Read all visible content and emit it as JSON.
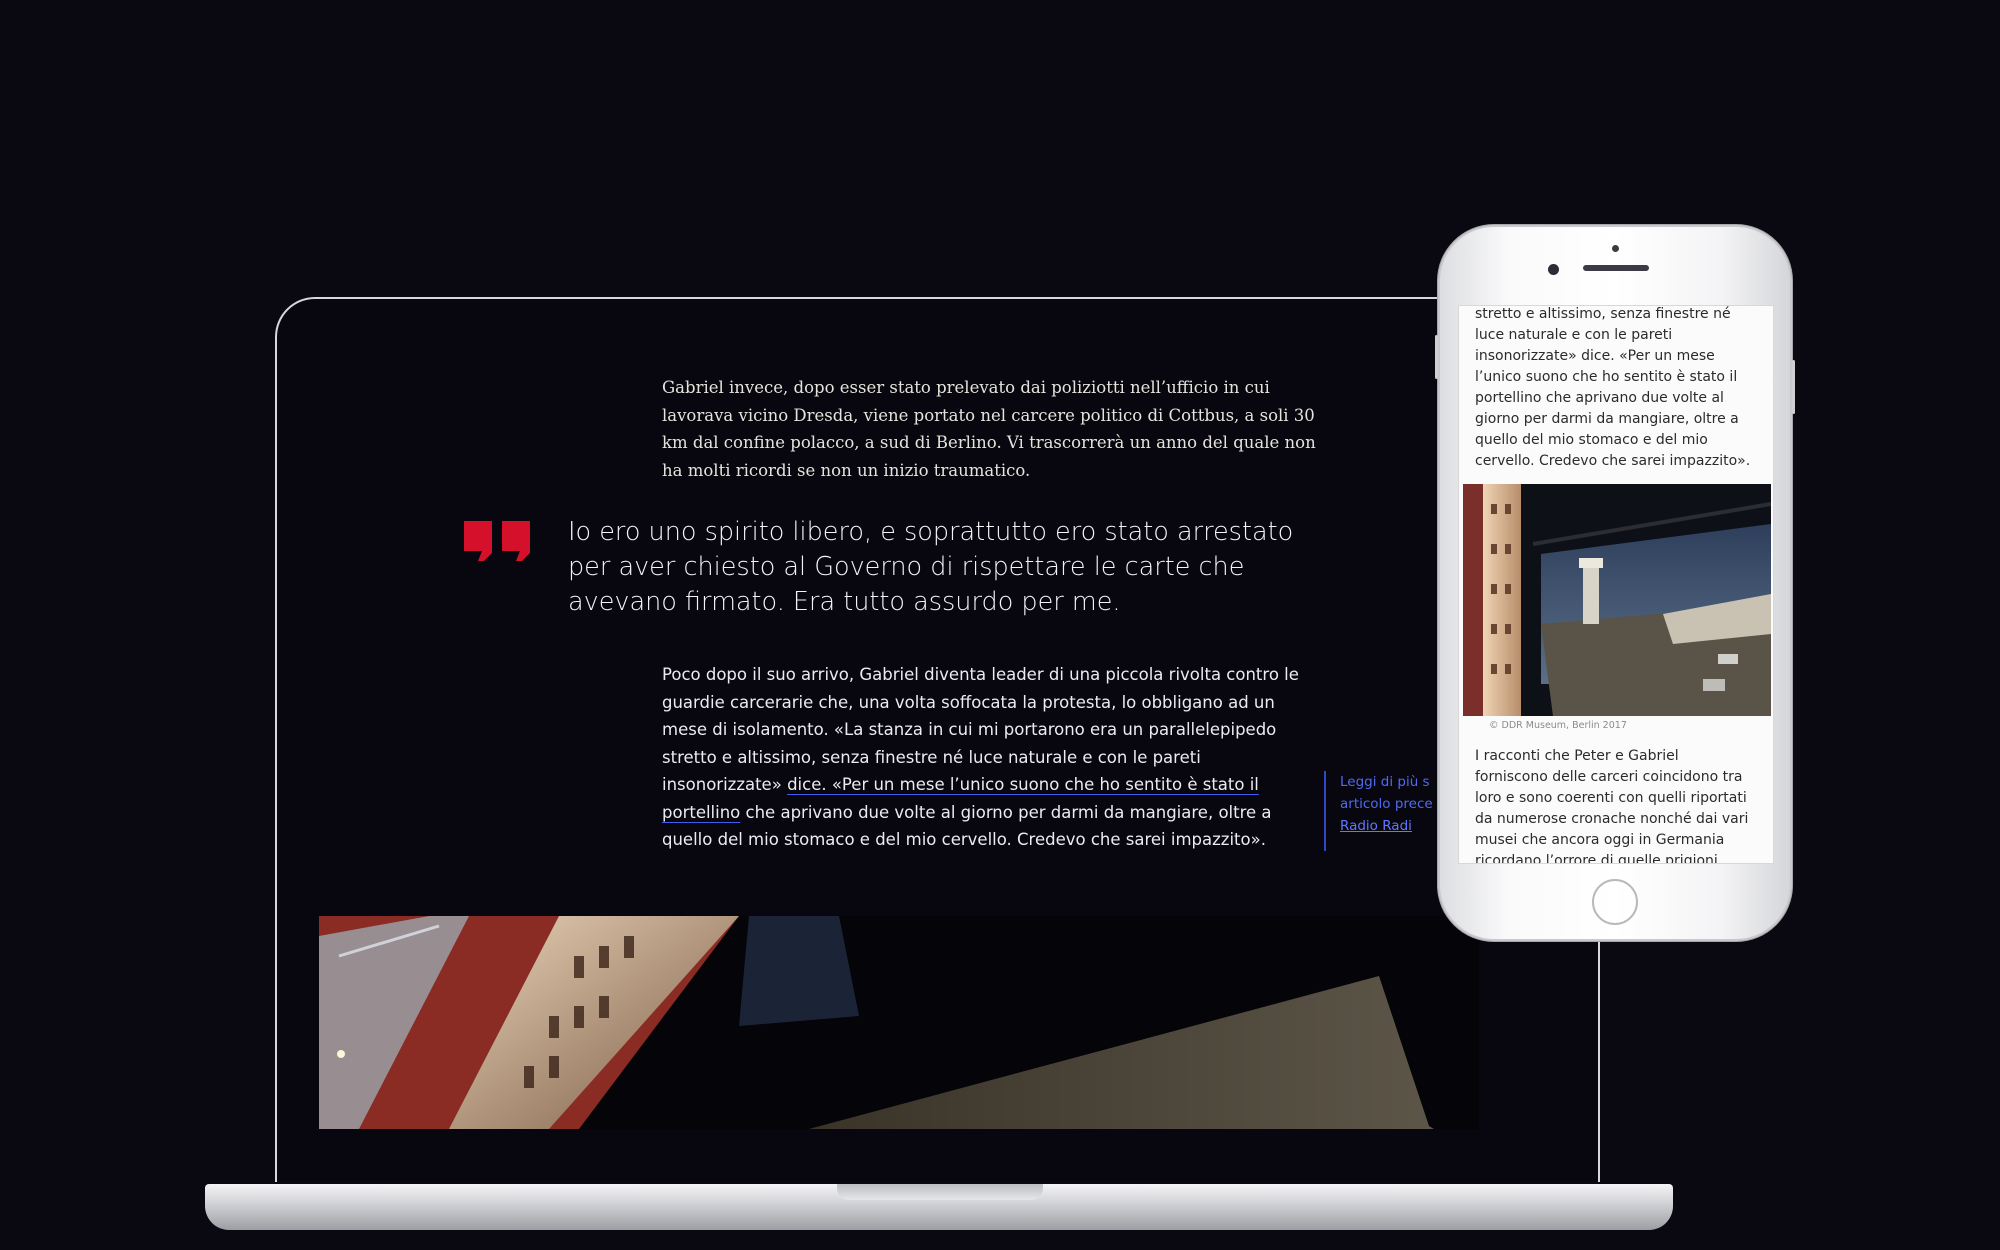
{
  "article": {
    "serif_paragraph": "Gabriel invece, dopo esser stato prelevato dai poliziotti nell’ufficio in cui lavorava vicino Dresda, viene portato nel carcere politico di Cottbus, a soli 30 km dal confine polacco, a sud di Berlino. Vi trascorrerà un anno del quale non ha molti ricordi se non un inizio traumatico.",
    "quote": "Io ero uno spirito libero, e soprattutto ero stato arrestato per aver chiesto al Governo di rispettare le carte che avevano firmato. Era tutto assurdo per me.",
    "body_before_link": "Poco dopo il suo arrivo, Gabriel diventa leader di una piccola rivolta contro le guardie carcerarie che, una volta soffocata la protesta, lo obbligano ad un mese di isolamento. «La stanza in cui mi portarono era un parallelepipedo stretto e altissimo, senza finestre né luce naturale e con le pareti insonorizzate»",
    "body_link": "dice. «Per un mese l’unico suono che ho sentito è stato il portellino",
    "body_after_link": "che aprivano due volte al giorno per darmi da mangiare, oltre a quello del mio stomaco e del mio cervello. Credevo che sarei impazzito».",
    "sidenote_text": "Leggi di più s articolo prece di",
    "sidenote_link": "Radio Radi"
  },
  "phone": {
    "top_text": "stretto e altissimo, senza finestre né luce naturale e con le pareti insonorizzate» dice. «Per un mese l’unico suono che ho sentito è stato il portellino che aprivano due volte al giorno per darmi da mangiare, oltre a quello del mio stomaco e del mio cervello. Credevo che sarei impazzito».",
    "caption": "© DDR Museum, Berlin 2017",
    "bottom_text": "I racconti che Peter e Gabriel forniscono delle carceri coincidono tra loro e sono coerenti con quelli riportati da numerose cronache nonché dai vari musei che ancora oggi in Germania ricordano l’orrore di quelle prigioni"
  },
  "colors": {
    "background": "#0a0912",
    "quote_mark": "#d4102a",
    "link_underline": "#3f5cf0"
  },
  "icons": {
    "quote_mark": "quote-mark-icon"
  }
}
